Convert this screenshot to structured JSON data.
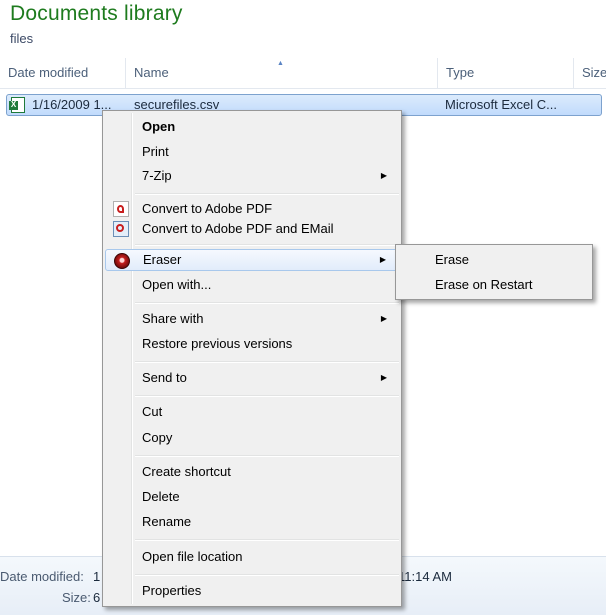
{
  "library": {
    "title": "Documents library",
    "subtitle": "files"
  },
  "columns": {
    "date_modified": "Date modified",
    "name": "Name",
    "type": "Type",
    "size": "Size"
  },
  "file": {
    "date": "1/16/2009 1...",
    "name": "securefiles.csv",
    "type": "Microsoft Excel C...",
    "icon": "excel-csv-icon"
  },
  "details": {
    "date_label": "Date modified:",
    "date_value": "1",
    "time_value": "11:14 AM",
    "size_label": "Size:",
    "size_value": "6"
  },
  "context_menu": {
    "open": "Open",
    "print": "Print",
    "seven_zip": "7-Zip",
    "convert_pdf": "Convert to Adobe PDF",
    "convert_pdf_email": "Convert to Adobe PDF and EMail",
    "eraser": "Eraser",
    "open_with": "Open with...",
    "share_with": "Share with",
    "restore": "Restore previous versions",
    "send_to": "Send to",
    "cut": "Cut",
    "copy": "Copy",
    "create_shortcut": "Create shortcut",
    "delete": "Delete",
    "rename": "Rename",
    "open_location": "Open file location",
    "properties": "Properties"
  },
  "eraser_submenu": {
    "erase": "Erase",
    "erase_on_restart": "Erase on Restart"
  },
  "colors": {
    "title_green": "#1e7b1e",
    "selection": "#c1dbfc",
    "menu_bg": "#f0f0f0"
  }
}
